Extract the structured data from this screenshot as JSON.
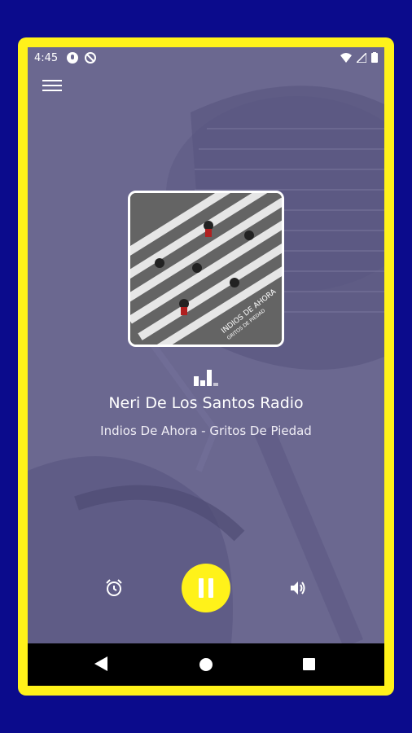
{
  "status_bar": {
    "time": "4:45",
    "left_icons": [
      "media-icon",
      "no-data-icon"
    ],
    "right_icons": [
      "wifi-icon",
      "signal-icon",
      "battery-icon"
    ]
  },
  "toolbar": {
    "menu_icon": "hamburger-menu-icon"
  },
  "album": {
    "art_text_line1": "INDIOS DE AHORA",
    "art_text_line2": "GRITOS DE PIEDAD"
  },
  "now_playing": {
    "station_name": "Neri De Los Santos Radio",
    "track": "Indios De Ahora - Gritos De Piedad"
  },
  "controls": {
    "alarm_icon": "alarm-clock-icon",
    "play_state": "pause",
    "volume_icon": "volume-icon"
  },
  "nav": {
    "back": "back-icon",
    "home": "home-icon",
    "recents": "recents-icon"
  },
  "colors": {
    "frame": "#fff21a",
    "background": "#0b0b8c",
    "overlay": "#6d6a92",
    "accent": "#fff21a"
  }
}
